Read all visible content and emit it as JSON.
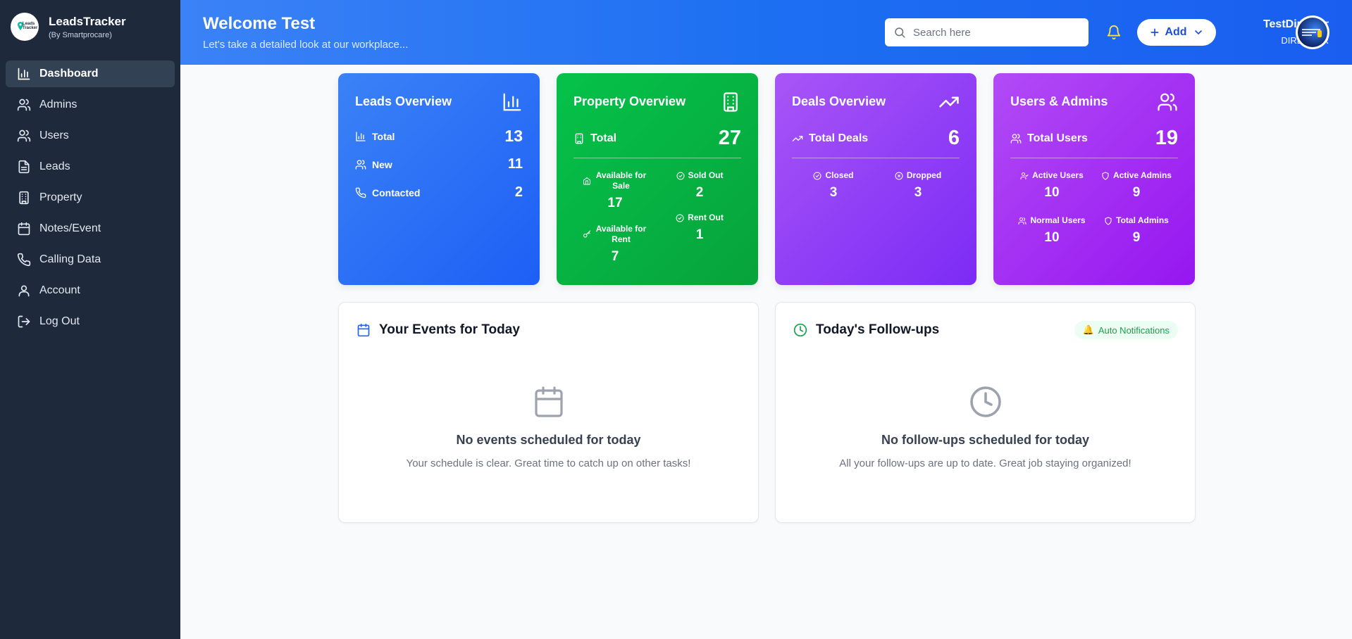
{
  "brand": {
    "title": "LeadsTracker",
    "subtitle": "(By Smartprocare)",
    "logo_text": "Leads Tracker"
  },
  "sidebar": {
    "items": [
      {
        "label": "Dashboard",
        "icon": "bar-chart-icon",
        "active": true
      },
      {
        "label": "Admins",
        "icon": "users-icon"
      },
      {
        "label": "Users",
        "icon": "users-icon"
      },
      {
        "label": "Leads",
        "icon": "document-icon"
      },
      {
        "label": "Property",
        "icon": "building-icon"
      },
      {
        "label": "Notes/Event",
        "icon": "calendar-icon"
      },
      {
        "label": "Calling Data",
        "icon": "phone-icon"
      },
      {
        "label": "Account",
        "icon": "user-icon"
      },
      {
        "label": "Log Out",
        "icon": "logout-icon"
      }
    ]
  },
  "header": {
    "welcome": "Welcome Test",
    "subtitle": "Let's take a detailed look at our workplace...",
    "search_placeholder": "Search here",
    "add_label": "Add",
    "user_name": "TestDirector",
    "user_role": "DIRECTOR"
  },
  "cards": {
    "leads": {
      "title": "Leads Overview",
      "total_label": "Total",
      "total_value": "13",
      "new_label": "New",
      "new_value": "11",
      "contacted_label": "Contacted",
      "contacted_value": "2"
    },
    "property": {
      "title": "Property Overview",
      "total_label": "Total",
      "total_value": "27",
      "sale_label": "Available for Sale",
      "sale_value": "17",
      "sold_label": "Sold Out",
      "sold_value": "2",
      "rent_label": "Available for Rent",
      "rent_value": "7",
      "rentout_label": "Rent Out",
      "rentout_value": "1"
    },
    "deals": {
      "title": "Deals Overview",
      "total_label": "Total Deals",
      "total_value": "6",
      "closed_label": "Closed",
      "closed_value": "3",
      "dropped_label": "Dropped",
      "dropped_value": "3"
    },
    "users": {
      "title": "Users & Admins",
      "total_label": "Total Users",
      "total_value": "19",
      "active_users_label": "Active Users",
      "active_users_value": "10",
      "active_admins_label": "Active Admins",
      "active_admins_value": "9",
      "normal_users_label": "Normal Users",
      "normal_users_value": "10",
      "total_admins_label": "Total Admins",
      "total_admins_value": "9"
    }
  },
  "events": {
    "title": "Your Events for Today",
    "empty_title": "No events scheduled for today",
    "empty_sub": "Your schedule is clear. Great time to catch up on other tasks!"
  },
  "followups": {
    "title": "Today's Follow-ups",
    "badge": "Auto Notifications",
    "empty_title": "No follow-ups scheduled for today",
    "empty_sub": "All your follow-ups are up to date. Great job staying organized!"
  },
  "colors": {
    "sidebar": "#1e293b",
    "header": "#2563eb",
    "leads": "#3b82f6",
    "property": "#06b845",
    "deals": "#9333ea",
    "users": "#a21caf"
  }
}
